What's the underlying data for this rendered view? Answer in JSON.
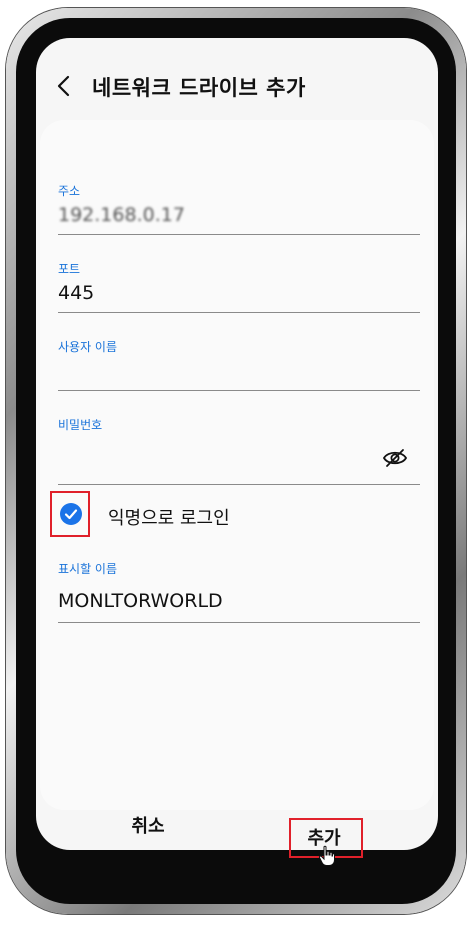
{
  "header": {
    "title": "네트워크 드라이브 추가"
  },
  "form": {
    "address": {
      "label": "주소",
      "value": "192.168.0.17"
    },
    "port": {
      "label": "포트",
      "value": "445"
    },
    "username": {
      "label": "사용자 이름",
      "value": ""
    },
    "password": {
      "label": "비밀번호",
      "value": ""
    },
    "anonymous_login": {
      "label": "익명으로 로그인",
      "checked": true
    },
    "display_name": {
      "label": "표시할 이름",
      "value": "MONLTORWORLD"
    }
  },
  "actions": {
    "cancel_label": "취소",
    "add_label": "추가"
  },
  "icons": {
    "back": "chevron-left-icon",
    "password_toggle": "eye-off-icon",
    "checkbox": "check-icon",
    "pointer": "hand-pointer-icon"
  },
  "colors": {
    "accent": "#1a73e8",
    "highlight": "#e0202a"
  }
}
